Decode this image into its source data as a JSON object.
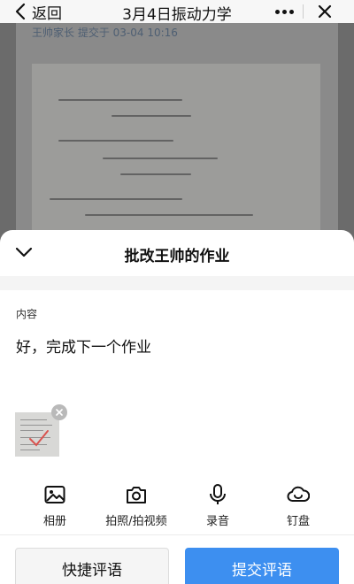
{
  "navbar": {
    "back_label": "返回",
    "title": "3月4日振动力学"
  },
  "background": {
    "meta": "王帅家长 提交于 03-04 10:16"
  },
  "sheet": {
    "title": "批改王帅的作业",
    "content_label": "内容",
    "comment_value": "好，完成下一个作业"
  },
  "toolbar": {
    "items": [
      {
        "label": "相册",
        "icon": "album-icon"
      },
      {
        "label": "拍照/拍视频",
        "icon": "camera-icon"
      },
      {
        "label": "录音",
        "icon": "microphone-icon"
      },
      {
        "label": "钉盘",
        "icon": "cloud-drive-icon"
      }
    ]
  },
  "actions": {
    "quick_label": "快捷评语",
    "submit_label": "提交评语"
  },
  "colors": {
    "accent": "#3d8ff0",
    "overlay": "#7a7a7a"
  }
}
